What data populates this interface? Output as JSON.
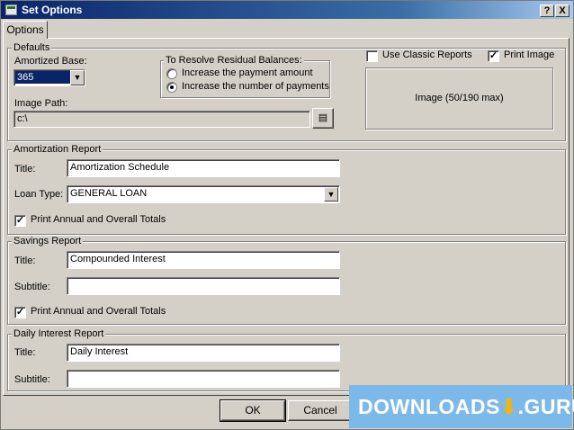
{
  "window": {
    "title": "Set Options",
    "help_label": "?",
    "close_label": "X"
  },
  "tabs": [
    {
      "label": "Options"
    }
  ],
  "defaults": {
    "legend": "Defaults",
    "amortized_base_label": "Amortized Base:",
    "amortized_base_value": "365",
    "residual": {
      "legend": "To Resolve Residual Balances:",
      "options": [
        "Increase the payment amount",
        "Increase the number of payments"
      ],
      "selected_index": 1
    },
    "image_path_label": "Image Path:",
    "image_path_value": "c:\\",
    "use_classic_reports_label": "Use Classic Reports",
    "use_classic_reports_checked": false,
    "print_image_label": "Print Image",
    "print_image_checked": true,
    "image_box_text": "Image (50/190 max)"
  },
  "amortization_report": {
    "legend": "Amortization Report",
    "title_label": "Title:",
    "title_value": "Amortization Schedule",
    "loan_type_label": "Loan Type:",
    "loan_type_value": "GENERAL LOAN",
    "print_totals_label": "Print Annual and Overall Totals",
    "print_totals_checked": true
  },
  "savings_report": {
    "legend": "Savings Report",
    "title_label": "Title:",
    "title_value": "Compounded Interest",
    "subtitle_label": "Subtitle:",
    "subtitle_value": "",
    "print_totals_label": "Print Annual and Overall Totals",
    "print_totals_checked": true
  },
  "daily_interest_report": {
    "legend": "Daily Interest Report",
    "title_label": "Title:",
    "title_value": "Daily Interest",
    "subtitle_label": "Subtitle:",
    "subtitle_value": ""
  },
  "buttons": {
    "ok": "OK",
    "cancel": "Cancel"
  },
  "icons": {
    "dropdown": "chevron-down-icon",
    "browse": "folder-browse-icon"
  },
  "check_glyph": "✓",
  "watermark": {
    "text_left": "DOWNLOADS",
    "arrow": "⬇",
    "text_right": ".GURU"
  },
  "colors": {
    "titlebar": "#0a246a",
    "dialog_face": "#d4d0c8",
    "watermark_bg": "#7db9e8"
  }
}
